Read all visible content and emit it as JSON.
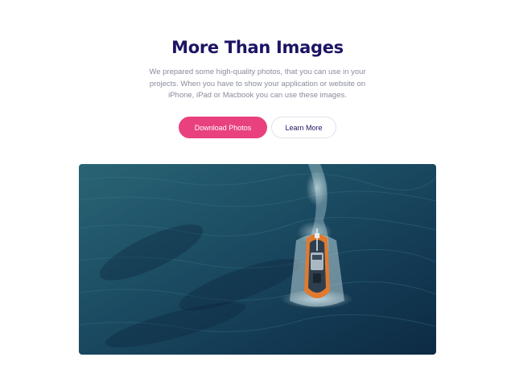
{
  "section": {
    "title": "More Than Images",
    "description": "We prepared some high-quality photos, that you can use in your projects. When you have to show your application or website on iPhone, iPad or Macbook you can use these images."
  },
  "buttons": {
    "primary_label": "Download Photos",
    "secondary_label": "Learn More"
  },
  "image": {
    "subject": "aerial view of a boat speeding across dark blue sea"
  },
  "colors": {
    "title": "#1c1464",
    "primary_button": "#e8417e",
    "body_text": "#8a8d9c",
    "sea": "#163e56"
  }
}
